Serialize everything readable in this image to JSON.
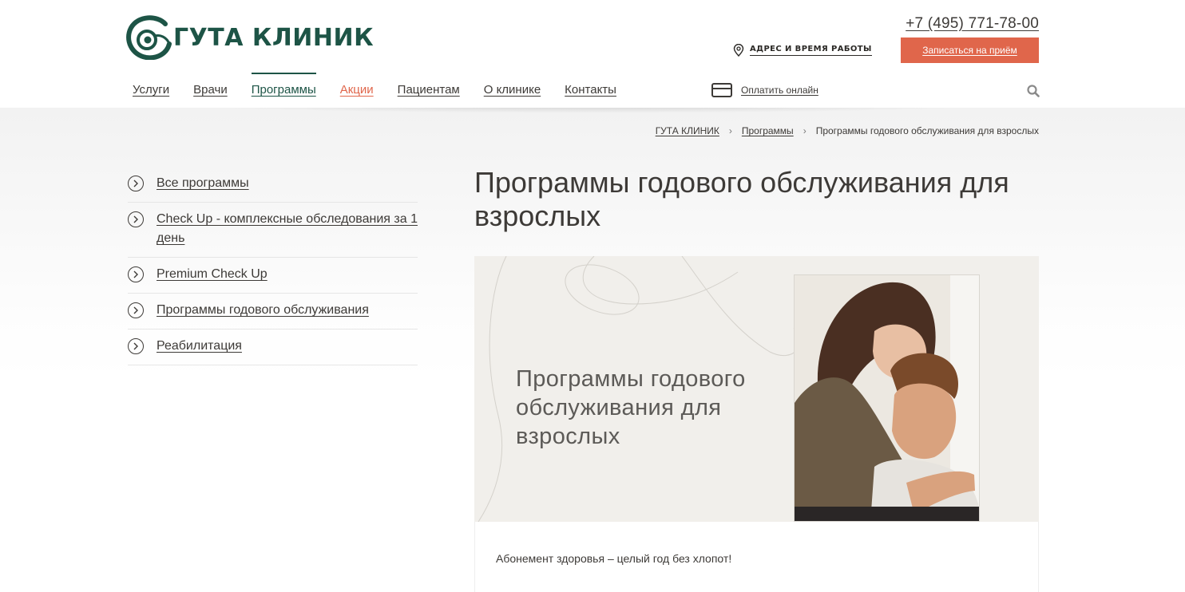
{
  "header": {
    "logo_text": "ГУТА КЛИНИК",
    "phone": "+7 (495) 771-78-00",
    "address_link": "АДРЕС И ВРЕМЯ РАБОТЫ",
    "cta_button": "Записаться на приём",
    "pay_online": "Оплатить онлайн"
  },
  "nav": {
    "items": [
      {
        "label": "Услуги"
      },
      {
        "label": "Врачи"
      },
      {
        "label": "Программы"
      },
      {
        "label": "Акции"
      },
      {
        "label": "Пациентам"
      },
      {
        "label": "О клинике"
      },
      {
        "label": "Контакты"
      }
    ]
  },
  "breadcrumb": {
    "home": "ГУТА КЛИНИК",
    "section": "Программы",
    "current": "Программы годового обслуживания для взрослых"
  },
  "sidebar": {
    "items": [
      {
        "label": "Все программы"
      },
      {
        "label": "Check Up - комплексные обследования за 1 день"
      },
      {
        "label": "Premium Check Up"
      },
      {
        "label": "Программы годового обслуживания"
      },
      {
        "label": "Реабилитация"
      }
    ]
  },
  "main": {
    "title": "Программы годового обслуживания для взрослых",
    "banner_text": "Программы годового обслуживания для взрослых",
    "intro": "Абонемент здоровья – целый год без хлопот!"
  },
  "colors": {
    "brand_green": "#1d5446",
    "accent_orange": "#e0664b",
    "text": "#3d3a37"
  }
}
